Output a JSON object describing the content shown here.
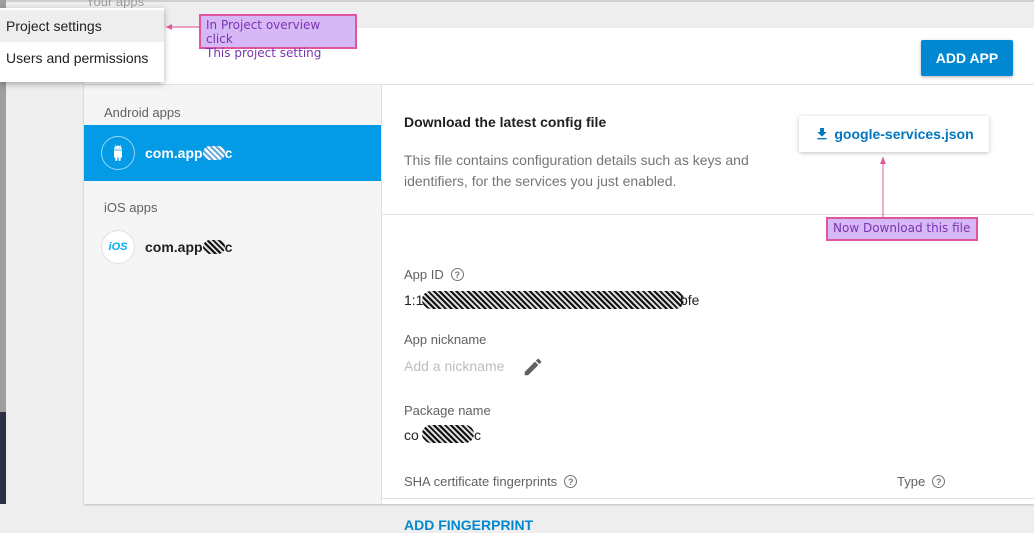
{
  "background_text": "Your apps",
  "menu": {
    "items": [
      {
        "label": "Project settings"
      },
      {
        "label": "Users and permissions"
      }
    ]
  },
  "annotations": {
    "menu_note": [
      "In Project overview click",
      "This project setting"
    ],
    "download_note": "Now Download this file"
  },
  "header": {
    "add_app_label": "ADD APP"
  },
  "sidebar": {
    "android_section": "Android apps",
    "ios_section": "iOS apps",
    "android_app": {
      "name": "com.app",
      "suffix": "c",
      "avatar_icon": "android-icon",
      "selected": true
    },
    "ios_app": {
      "name": "com.app",
      "suffix": "c",
      "avatar_text": "iOS",
      "selected": false
    }
  },
  "config": {
    "title": "Download the latest config file",
    "description": "This file contains configuration details such as keys and identifiers, for the services you just enabled.",
    "download_label": "google-services.json",
    "download_icon": "download-icon"
  },
  "fields": {
    "app_id_label": "App ID",
    "app_id_prefix": "1:1",
    "app_id_suffix": "bfe",
    "nickname_label": "App nickname",
    "nickname_placeholder": "Add a nickname",
    "package_label": "Package name",
    "package_prefix": "co",
    "package_suffix": "c",
    "sha_label": "SHA certificate fingerprints",
    "type_label": "Type",
    "add_fingerprint": "ADD FINGERPRINT"
  },
  "colors": {
    "primary": "#039be5",
    "button": "#0288d1",
    "annotation_fill": "#d7b8f7",
    "annotation_border": "#e0559b"
  }
}
